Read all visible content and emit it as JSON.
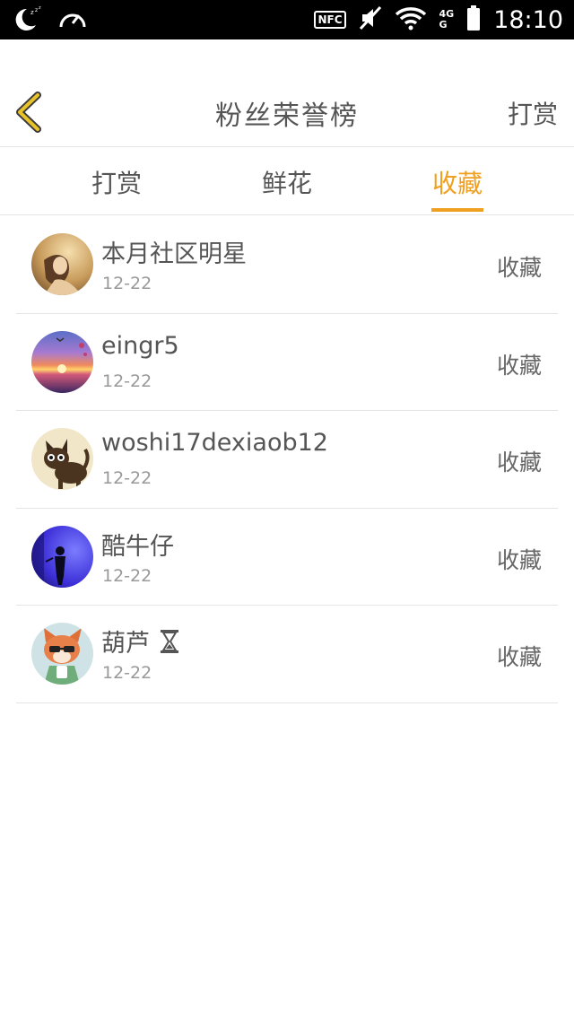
{
  "status_bar": {
    "time": "18:10",
    "nfc_label": "NFC",
    "network_top": "4G",
    "network_bottom": "G"
  },
  "header": {
    "title": "粉丝荣誉榜",
    "action_label": "打赏"
  },
  "tabs": [
    {
      "label": "打赏",
      "active": false
    },
    {
      "label": "鲜花",
      "active": false
    },
    {
      "label": "收藏",
      "active": true
    }
  ],
  "list": [
    {
      "name": "本月社区明星",
      "date": "12-22",
      "stat": "收藏",
      "avatar": "woman-portrait-avatar"
    },
    {
      "name": "eingr5",
      "date": "12-22",
      "stat": "收藏",
      "avatar": "sunset-avatar"
    },
    {
      "name": "woshi17dexiaob12",
      "date": "12-22",
      "stat": "收藏",
      "avatar": "cat-avatar"
    },
    {
      "name": "酷牛仔",
      "date": "12-22",
      "stat": "收藏",
      "avatar": "blue-silhouette-avatar"
    },
    {
      "name": "葫芦",
      "date": "12-22",
      "stat": "收藏",
      "avatar": "fox-avatar",
      "badge": "hourglass-icon"
    }
  ],
  "colors": {
    "accent": "#f0a020",
    "back_arrow": "#e8c22a",
    "text": "#555555",
    "muted": "#999999"
  }
}
